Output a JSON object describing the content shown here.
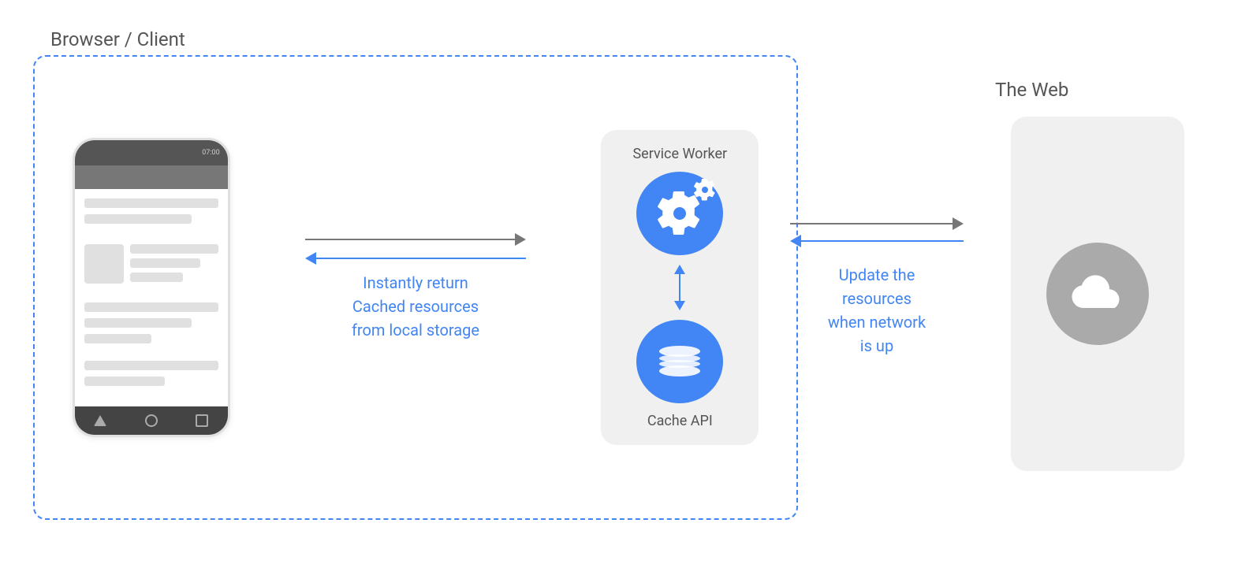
{
  "labels": {
    "browser_client": "Browser / Client",
    "the_web": "The Web",
    "service_worker": "Service Worker",
    "cache_api": "Cache API",
    "instantly_return": "Instantly return",
    "cached_resources": "Cached resources",
    "from_local_storage": "from local storage",
    "update_the": "Update the",
    "resources": "resources",
    "when_network": "when network",
    "is_up": "is up"
  },
  "colors": {
    "blue": "#4285F4",
    "dashed_border": "#4285F4",
    "panel_bg": "#f0f0f0",
    "dark_gray": "#777",
    "light_gray": "#e0e0e0",
    "cloud_bg": "#aaa"
  }
}
